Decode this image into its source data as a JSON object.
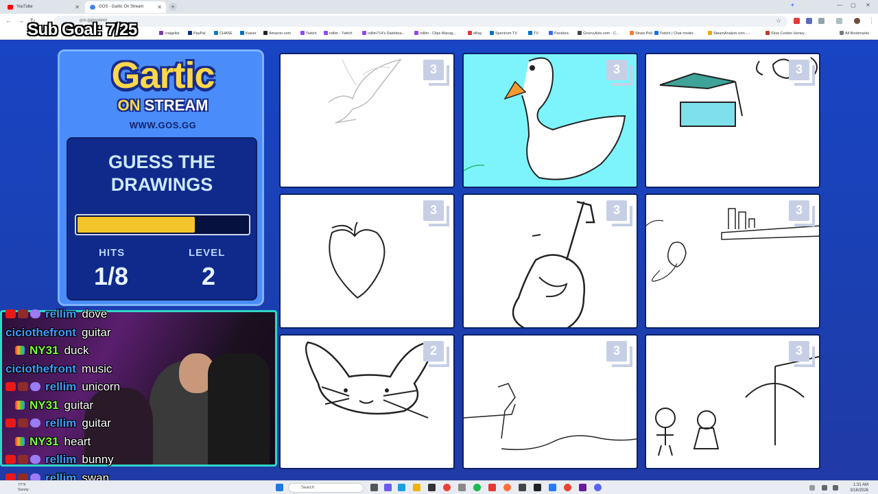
{
  "browser": {
    "tabs": [
      {
        "label": "YouTube",
        "color": "#ff0000"
      },
      {
        "label": "GOS - Gartic On Stream",
        "color": "#4285f4"
      }
    ],
    "address": "gos.gg/system/"
  },
  "bookmarks": [
    {
      "label": "craigslist",
      "color": "#7b3fa0"
    },
    {
      "label": "PayPal",
      "color": "#003087"
    },
    {
      "label": "CHASE",
      "color": "#117aca"
    },
    {
      "label": "Kaiser",
      "color": "#0a6ebd"
    },
    {
      "label": "Amazon.com",
      "color": "#222222"
    },
    {
      "label": "Twitch",
      "color": "#9146ff"
    },
    {
      "label": "rellim - Twitch",
      "color": "#9146ff"
    },
    {
      "label": "rellim714's Dashboa...",
      "color": "#9146ff"
    },
    {
      "label": "rellim - Clips Manag...",
      "color": "#9146ff"
    },
    {
      "label": "eBay",
      "color": "#e53238"
    },
    {
      "label": "Spectrum TV",
      "color": "#0071c5"
    },
    {
      "label": "TV",
      "color": "#0071c5"
    },
    {
      "label": "Pandora",
      "color": "#3668ff"
    },
    {
      "label": "Groovylists.com - C...",
      "color": "#444444"
    },
    {
      "label": "Straw Poll",
      "color": "#f47d31"
    },
    {
      "label": "Twitch | Chat moder...",
      "color": "#1a73e8"
    },
    {
      "label": "SteamAnalyst.com -...",
      "color": "#e6a800"
    },
    {
      "label": "Slow Cooker Honey...",
      "color": "#c0392b"
    }
  ],
  "all_bookmarks": "All Bookmarks",
  "overlay": {
    "sub_goal": "Sub Goal: 7/25"
  },
  "game": {
    "logo_main": "Gartic",
    "logo_on": "ON",
    "logo_stream": "STREAM",
    "site": "WWW.GOS.GG",
    "title_line1": "GUESS THE",
    "title_line2": "DRAWINGS",
    "progress_fraction": 0.68,
    "hits_label": "HITS",
    "hits_value": "1/8",
    "level_label": "LEVEL",
    "level_value": "2",
    "cells": [
      {
        "badge": "3",
        "drawing": "dove"
      },
      {
        "badge": "3",
        "drawing": "duck"
      },
      {
        "badge": "3",
        "drawing": "box"
      },
      {
        "badge": "3",
        "drawing": "heart-apple"
      },
      {
        "badge": "3",
        "drawing": "guitar"
      },
      {
        "badge": "3",
        "drawing": "shelf"
      },
      {
        "badge": "2",
        "drawing": "bunny"
      },
      {
        "badge": "3",
        "drawing": "landscape"
      },
      {
        "badge": "3",
        "drawing": "couple"
      }
    ]
  },
  "chat": [
    {
      "user": "rellim",
      "msg": "dove",
      "color": "#3d9cff",
      "badges": true
    },
    {
      "user": "ciciothefront",
      "msg": "guitar",
      "color": "#3d9cff",
      "badges": false
    },
    {
      "user": "NY31",
      "msg": "duck",
      "color": "#7cfc3c",
      "badges": false
    },
    {
      "user": "ciciothefront",
      "msg": "music",
      "color": "#3d9cff",
      "badges": false
    },
    {
      "user": "rellim",
      "msg": "unicorn",
      "color": "#3d9cff",
      "badges": true
    },
    {
      "user": "NY31",
      "msg": "guitar",
      "color": "#7cfc3c",
      "badges": false
    },
    {
      "user": "rellim",
      "msg": "guitar",
      "color": "#3d9cff",
      "badges": true
    },
    {
      "user": "NY31",
      "msg": "heart",
      "color": "#7cfc3c",
      "badges": false
    },
    {
      "user": "rellim",
      "msg": "bunny",
      "color": "#3d9cff",
      "badges": true
    },
    {
      "user": "rellim",
      "msg": "swan",
      "color": "#3d9cff",
      "badges": true
    }
  ],
  "taskbar": {
    "search": "Search",
    "weather_temp": "77°F",
    "weather_text": "Sunny",
    "time": "1:31 AM",
    "date": "3/16/2026"
  }
}
